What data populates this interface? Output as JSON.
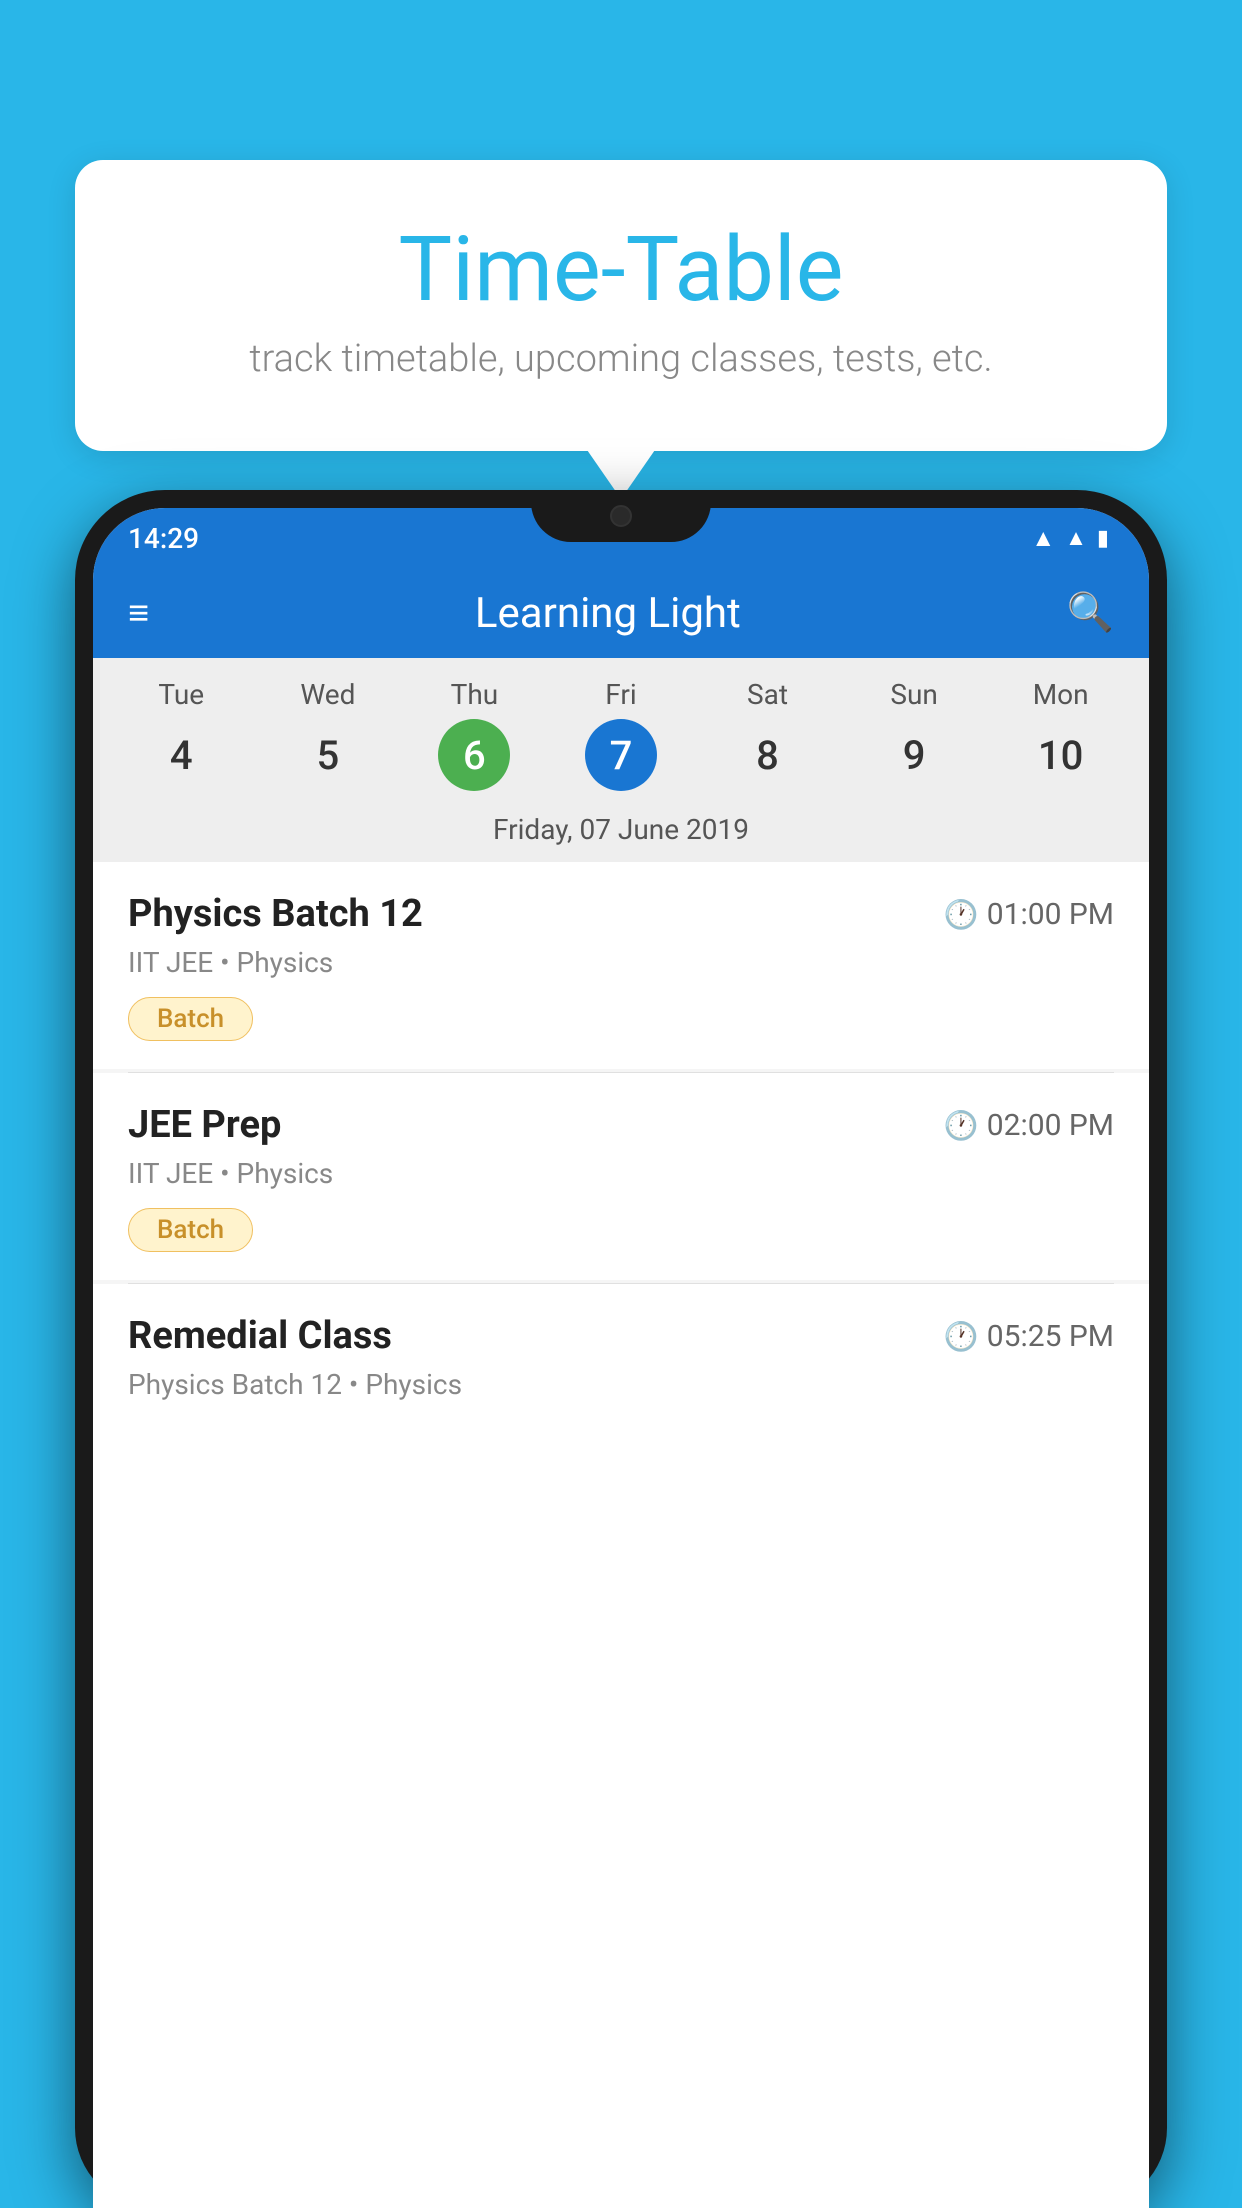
{
  "background_color": "#29b6e8",
  "bubble": {
    "title": "Time-Table",
    "subtitle": "track timetable, upcoming classes, tests, etc."
  },
  "status_bar": {
    "time": "14:29",
    "icons": [
      "wifi",
      "signal",
      "battery"
    ]
  },
  "app_bar": {
    "title": "Learning Light",
    "menu_icon": "≡",
    "search_icon": "🔍"
  },
  "calendar": {
    "days": [
      {
        "label": "Tue",
        "number": "4",
        "state": "normal"
      },
      {
        "label": "Wed",
        "number": "5",
        "state": "normal"
      },
      {
        "label": "Thu",
        "number": "6",
        "state": "today"
      },
      {
        "label": "Fri",
        "number": "7",
        "state": "selected"
      },
      {
        "label": "Sat",
        "number": "8",
        "state": "normal"
      },
      {
        "label": "Sun",
        "number": "9",
        "state": "normal"
      },
      {
        "label": "Mon",
        "number": "10",
        "state": "normal"
      }
    ],
    "selected_date_label": "Friday, 07 June 2019"
  },
  "classes": [
    {
      "name": "Physics Batch 12",
      "time": "01:00 PM",
      "meta": "IIT JEE • Physics",
      "tag": "Batch"
    },
    {
      "name": "JEE Prep",
      "time": "02:00 PM",
      "meta": "IIT JEE • Physics",
      "tag": "Batch"
    },
    {
      "name": "Remedial Class",
      "time": "05:25 PM",
      "meta": "Physics Batch 12 • Physics",
      "tag": null
    }
  ]
}
